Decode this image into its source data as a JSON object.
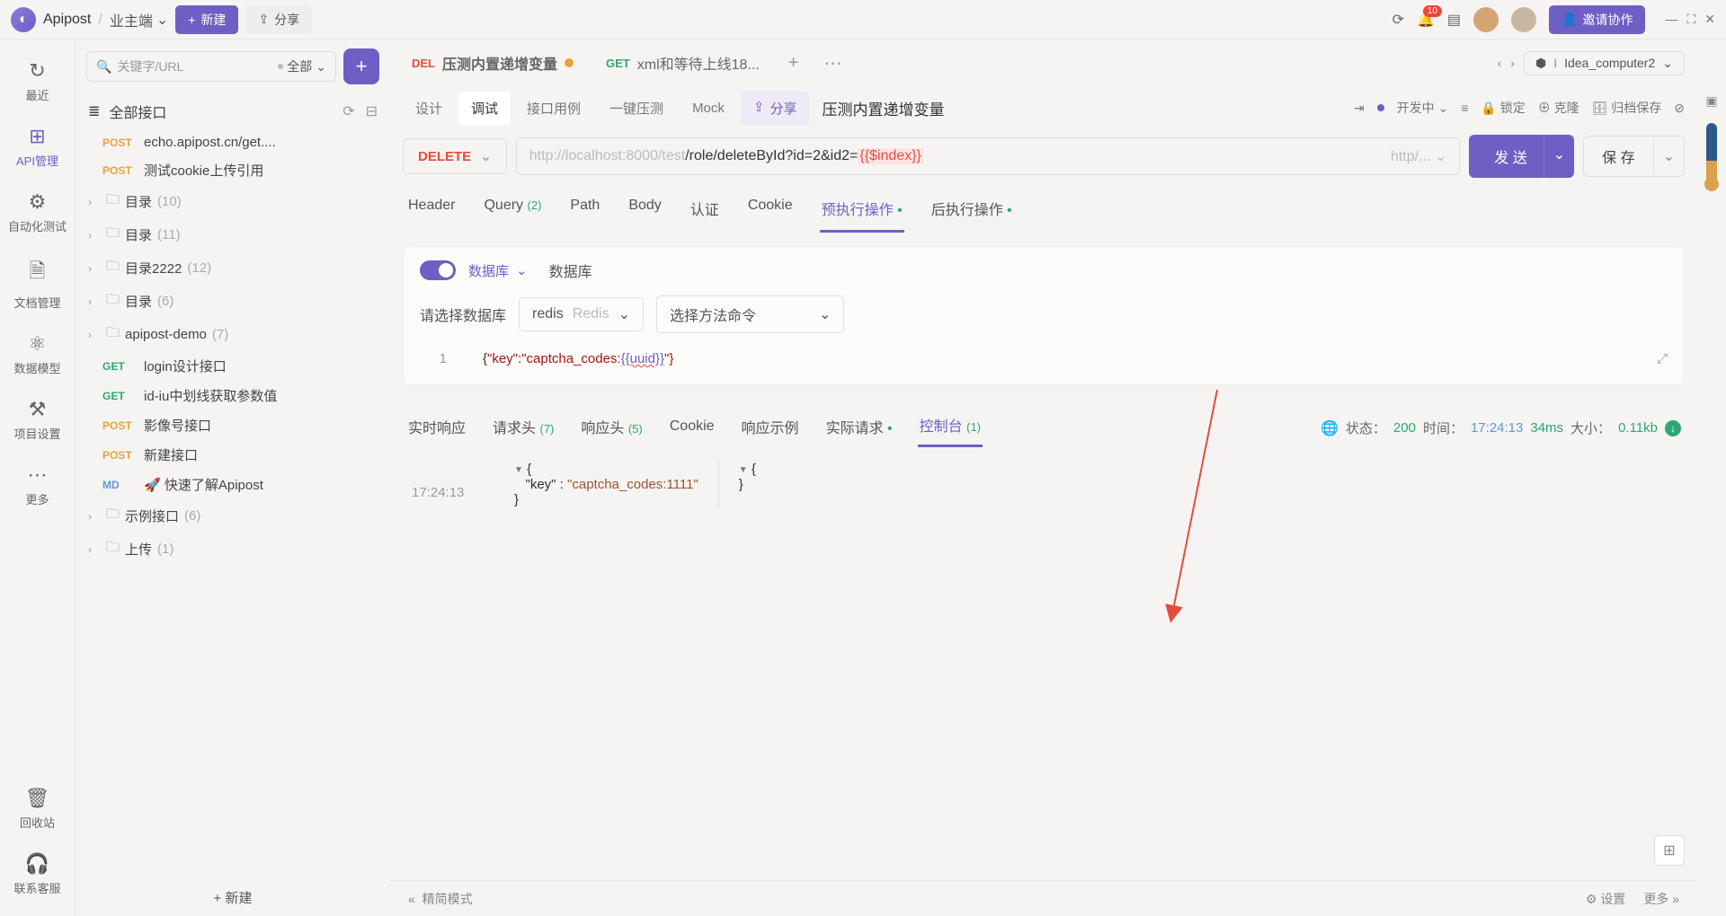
{
  "app": {
    "name": "Apipost",
    "workspace": "业主端"
  },
  "topbar": {
    "new": "新建",
    "share": "分享",
    "invite": "邀请协作",
    "notif_count": "10",
    "env": "Idea_computer2"
  },
  "rail": {
    "items": [
      {
        "icon": "↻",
        "label": "最近"
      },
      {
        "icon": "⊞",
        "label": "API管理"
      },
      {
        "icon": "⚙",
        "label": "自动化测试"
      },
      {
        "icon": "🗎",
        "label": "文档管理"
      },
      {
        "icon": "⚛",
        "label": "数据模型"
      },
      {
        "icon": "⚒",
        "label": "项目设置"
      },
      {
        "icon": "⋯",
        "label": "更多"
      }
    ],
    "bottom": [
      {
        "icon": "🗑",
        "label": "回收站"
      },
      {
        "icon": "🎧",
        "label": "联系客服"
      }
    ]
  },
  "sidebar": {
    "search_ph": "关键字/URL",
    "all": "全部",
    "header": "全部接口",
    "new_btn": "新建",
    "tree": [
      {
        "type": "api",
        "method": "POST",
        "label": "echo.apipost.cn/get...."
      },
      {
        "type": "api",
        "method": "POST",
        "label": "测试cookie上传引用"
      },
      {
        "type": "folder",
        "label": "目录",
        "count": "(10)"
      },
      {
        "type": "folder",
        "label": "目录",
        "count": "(11)"
      },
      {
        "type": "folder",
        "label": "目录2222",
        "count": "(12)"
      },
      {
        "type": "folder",
        "label": "目录",
        "count": "(6)"
      },
      {
        "type": "folder",
        "label": "apipost-demo",
        "count": "(7)"
      },
      {
        "type": "api",
        "method": "GET",
        "label": "login设计接口"
      },
      {
        "type": "api",
        "method": "GET",
        "label": "id-iu中划线获取参数值"
      },
      {
        "type": "api",
        "method": "POST",
        "label": "影像号接口"
      },
      {
        "type": "api",
        "method": "POST",
        "label": "新建接口"
      },
      {
        "type": "api",
        "method": "MD",
        "label": "🚀 快速了解Apipost"
      },
      {
        "type": "folder",
        "label": "示例接口",
        "count": "(6)"
      },
      {
        "type": "folder",
        "label": "上传",
        "count": "(1)"
      }
    ]
  },
  "tabs": [
    {
      "method": "DEL",
      "mclass": "m-post",
      "color": "#e74c3c",
      "label": "压测内置递增变量",
      "dirty": true
    },
    {
      "method": "GET",
      "mclass": "m-get",
      "label": "xml和等待上线18...",
      "dirty": false
    }
  ],
  "subtabs": {
    "items": [
      "设计",
      "调试",
      "接口用例",
      "一键压测",
      "Mock"
    ],
    "share": "分享",
    "api_title": "压测内置递增变量",
    "status": "开发中",
    "right": [
      "锁定",
      "克隆",
      "归档保存"
    ]
  },
  "request": {
    "method": "DELETE",
    "base": "http://localhost:8000/test",
    "path": "/role/deleteById?id=2&id2=",
    "var": "{{$index}}",
    "proto": "http/...",
    "send": "发 送",
    "save": "保 存",
    "tabs": [
      "Header",
      "Query",
      "Path",
      "Body",
      "认证",
      "Cookie",
      "预执行操作",
      "后执行操作"
    ],
    "query_count": "(2)"
  },
  "pre": {
    "db_sel": "数据库",
    "db_title": "数据库",
    "cfg_label": "请选择数据库",
    "redis": "redis",
    "redis_ph": "Redis",
    "method_ph": "选择方法命令",
    "code": "{\"key\":\"captcha_codes:{{uuid}}\"}",
    "code_key": "\"key\"",
    "code_val_prefix": "\"captcha_codes:",
    "code_var": "{{uuid}}",
    "code_val_suffix": "\"}"
  },
  "resp": {
    "tabs": [
      "实时响应",
      "请求头",
      "响应头",
      "Cookie",
      "响应示例",
      "实际请求",
      "控制台"
    ],
    "req_head_n": "(7)",
    "resp_head_n": "(5)",
    "console_n": "(1)",
    "status_label": "状态：",
    "status_code": "200",
    "time_label": "时间：",
    "time_val": "17:24:13",
    "dur": "34ms",
    "size_label": "大小：",
    "size_val": "0.11kb"
  },
  "console": {
    "time": "17:24:13",
    "json1": {
      "key": "\"key\"",
      "sep": " : ",
      "val": "\"captcha_codes:1111\""
    }
  },
  "footer": {
    "compact": "精简模式",
    "settings": "设置",
    "more": "更多"
  }
}
